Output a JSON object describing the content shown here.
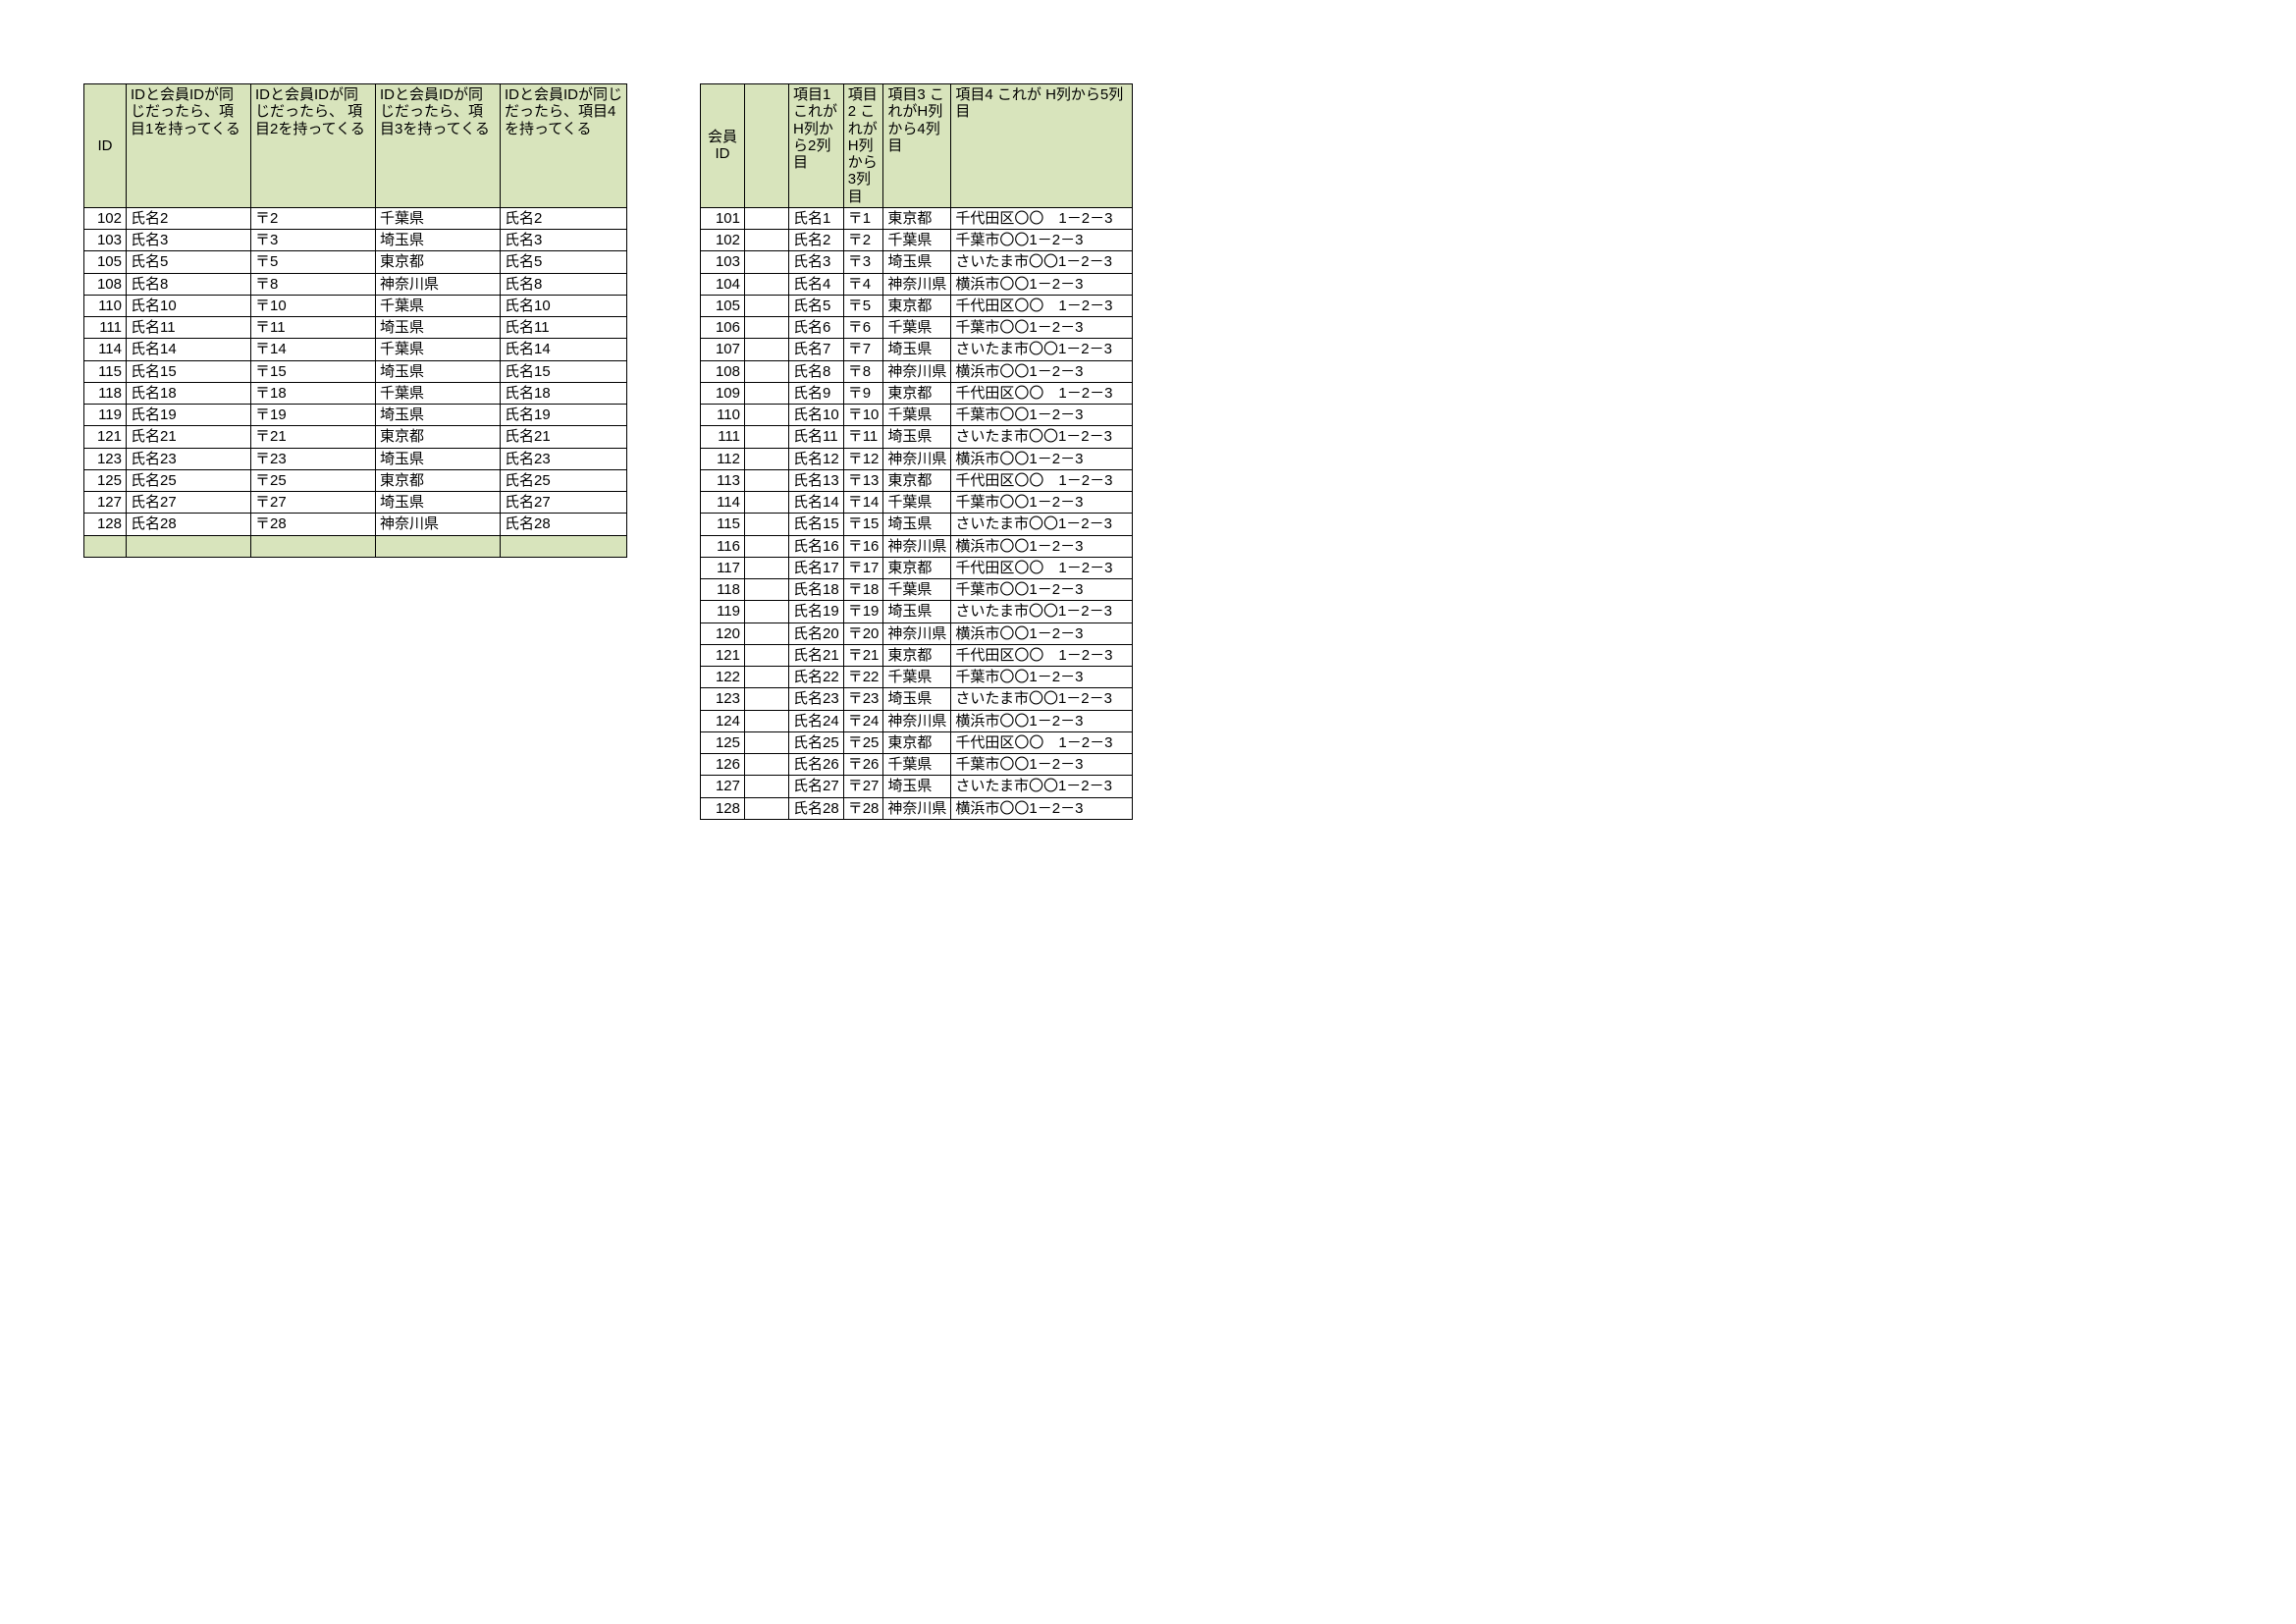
{
  "left": {
    "headers": {
      "id": "ID",
      "col1": "IDと会員IDが同じだったら、項目1を持ってくる",
      "col2": "IDと会員IDが同じだったら、\n項目2を持ってくる",
      "col3": "IDと会員IDが同じだったら、項目3を持ってくる",
      "col4": "IDと会員IDが同じだったら、項目4を持ってくる"
    },
    "rows": [
      {
        "id": "102",
        "c1": "氏名2",
        "c2": "〒2",
        "c3": "千葉県",
        "c4": "氏名2"
      },
      {
        "id": "103",
        "c1": "氏名3",
        "c2": "〒3",
        "c3": "埼玉県",
        "c4": "氏名3"
      },
      {
        "id": "105",
        "c1": "氏名5",
        "c2": "〒5",
        "c3": "東京都",
        "c4": "氏名5"
      },
      {
        "id": "108",
        "c1": "氏名8",
        "c2": "〒8",
        "c3": "神奈川県",
        "c4": "氏名8"
      },
      {
        "id": "110",
        "c1": "氏名10",
        "c2": "〒10",
        "c3": "千葉県",
        "c4": "氏名10"
      },
      {
        "id": "111",
        "c1": "氏名11",
        "c2": "〒11",
        "c3": "埼玉県",
        "c4": "氏名11"
      },
      {
        "id": "114",
        "c1": "氏名14",
        "c2": "〒14",
        "c3": "千葉県",
        "c4": "氏名14"
      },
      {
        "id": "115",
        "c1": "氏名15",
        "c2": "〒15",
        "c3": "埼玉県",
        "c4": "氏名15"
      },
      {
        "id": "118",
        "c1": "氏名18",
        "c2": "〒18",
        "c3": "千葉県",
        "c4": "氏名18"
      },
      {
        "id": "119",
        "c1": "氏名19",
        "c2": "〒19",
        "c3": "埼玉県",
        "c4": "氏名19"
      },
      {
        "id": "121",
        "c1": "氏名21",
        "c2": "〒21",
        "c3": "東京都",
        "c4": "氏名21"
      },
      {
        "id": "123",
        "c1": "氏名23",
        "c2": "〒23",
        "c3": "埼玉県",
        "c4": "氏名23"
      },
      {
        "id": "125",
        "c1": "氏名25",
        "c2": "〒25",
        "c3": "東京都",
        "c4": "氏名25"
      },
      {
        "id": "127",
        "c1": "氏名27",
        "c2": "〒27",
        "c3": "埼玉県",
        "c4": "氏名27"
      },
      {
        "id": "128",
        "c1": "氏名28",
        "c2": "〒28",
        "c3": "神奈川県",
        "c4": "氏名28"
      }
    ],
    "blank_tail_rows": 1
  },
  "right": {
    "headers": {
      "memberid": "会員ID",
      "spacer": "",
      "item1": "項目1\nこれがH列から2列目",
      "item2": "項目2\nこれがH列から3列目",
      "item3": "項目3\nこれがH列から4列目",
      "item4": "項目4\nこれが\nH列から5列目"
    },
    "rows": [
      {
        "id": "101",
        "name": "氏名1",
        "postal": "〒1",
        "pref": "東京都",
        "addr": "千代田区〇〇　1－2－3"
      },
      {
        "id": "102",
        "name": "氏名2",
        "postal": "〒2",
        "pref": "千葉県",
        "addr": "千葉市〇〇1－2－3"
      },
      {
        "id": "103",
        "name": "氏名3",
        "postal": "〒3",
        "pref": "埼玉県",
        "addr": "さいたま市〇〇1－2－3"
      },
      {
        "id": "104",
        "name": "氏名4",
        "postal": "〒4",
        "pref": "神奈川県",
        "addr": "横浜市〇〇1－2－3"
      },
      {
        "id": "105",
        "name": "氏名5",
        "postal": "〒5",
        "pref": "東京都",
        "addr": "千代田区〇〇　1－2－3"
      },
      {
        "id": "106",
        "name": "氏名6",
        "postal": "〒6",
        "pref": "千葉県",
        "addr": "千葉市〇〇1－2－3"
      },
      {
        "id": "107",
        "name": "氏名7",
        "postal": "〒7",
        "pref": "埼玉県",
        "addr": "さいたま市〇〇1－2－3"
      },
      {
        "id": "108",
        "name": "氏名8",
        "postal": "〒8",
        "pref": "神奈川県",
        "addr": "横浜市〇〇1－2－3"
      },
      {
        "id": "109",
        "name": "氏名9",
        "postal": "〒9",
        "pref": "東京都",
        "addr": "千代田区〇〇　1－2－3"
      },
      {
        "id": "110",
        "name": "氏名10",
        "postal": "〒10",
        "pref": "千葉県",
        "addr": "千葉市〇〇1－2－3"
      },
      {
        "id": "111",
        "name": "氏名11",
        "postal": "〒11",
        "pref": "埼玉県",
        "addr": "さいたま市〇〇1－2－3"
      },
      {
        "id": "112",
        "name": "氏名12",
        "postal": "〒12",
        "pref": "神奈川県",
        "addr": "横浜市〇〇1－2－3"
      },
      {
        "id": "113",
        "name": "氏名13",
        "postal": "〒13",
        "pref": "東京都",
        "addr": "千代田区〇〇　1－2－3"
      },
      {
        "id": "114",
        "name": "氏名14",
        "postal": "〒14",
        "pref": "千葉県",
        "addr": "千葉市〇〇1－2－3"
      },
      {
        "id": "115",
        "name": "氏名15",
        "postal": "〒15",
        "pref": "埼玉県",
        "addr": "さいたま市〇〇1－2－3"
      },
      {
        "id": "116",
        "name": "氏名16",
        "postal": "〒16",
        "pref": "神奈川県",
        "addr": "横浜市〇〇1－2－3"
      },
      {
        "id": "117",
        "name": "氏名17",
        "postal": "〒17",
        "pref": "東京都",
        "addr": "千代田区〇〇　1－2－3"
      },
      {
        "id": "118",
        "name": "氏名18",
        "postal": "〒18",
        "pref": "千葉県",
        "addr": "千葉市〇〇1－2－3"
      },
      {
        "id": "119",
        "name": "氏名19",
        "postal": "〒19",
        "pref": "埼玉県",
        "addr": "さいたま市〇〇1－2－3"
      },
      {
        "id": "120",
        "name": "氏名20",
        "postal": "〒20",
        "pref": "神奈川県",
        "addr": "横浜市〇〇1－2－3"
      },
      {
        "id": "121",
        "name": "氏名21",
        "postal": "〒21",
        "pref": "東京都",
        "addr": "千代田区〇〇　1－2－3"
      },
      {
        "id": "122",
        "name": "氏名22",
        "postal": "〒22",
        "pref": "千葉県",
        "addr": "千葉市〇〇1－2－3"
      },
      {
        "id": "123",
        "name": "氏名23",
        "postal": "〒23",
        "pref": "埼玉県",
        "addr": "さいたま市〇〇1－2－3"
      },
      {
        "id": "124",
        "name": "氏名24",
        "postal": "〒24",
        "pref": "神奈川県",
        "addr": "横浜市〇〇1－2－3"
      },
      {
        "id": "125",
        "name": "氏名25",
        "postal": "〒25",
        "pref": "東京都",
        "addr": "千代田区〇〇　1－2－3"
      },
      {
        "id": "126",
        "name": "氏名26",
        "postal": "〒26",
        "pref": "千葉県",
        "addr": "千葉市〇〇1－2－3"
      },
      {
        "id": "127",
        "name": "氏名27",
        "postal": "〒27",
        "pref": "埼玉県",
        "addr": "さいたま市〇〇1－2－3"
      },
      {
        "id": "128",
        "name": "氏名28",
        "postal": "〒28",
        "pref": "神奈川県",
        "addr": "横浜市〇〇1－2－3"
      }
    ]
  }
}
